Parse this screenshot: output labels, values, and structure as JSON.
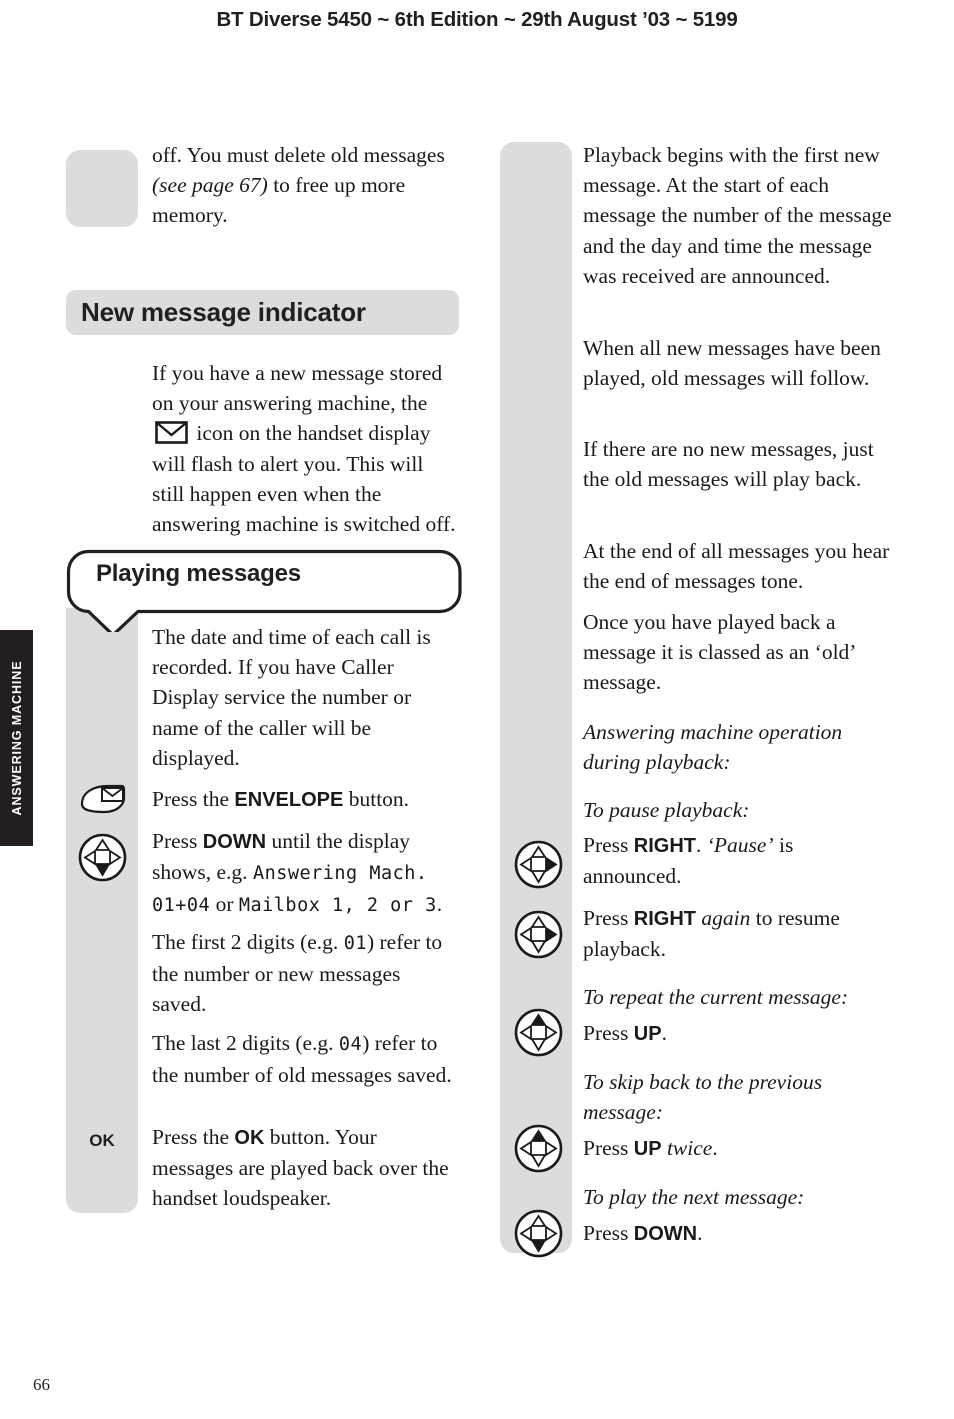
{
  "header": {
    "title": "BT Diverse 5450 ~ 6th Edition ~ 29th August ’03 ~ 5199"
  },
  "chapter_tab": {
    "label": "ANSWERING MACHINE"
  },
  "page_number": "66",
  "left_column": {
    "continued_paragraph_html": "off. You must delete old messages <i>(see page 67)</i> to free up more memory.",
    "section_heading": "New message indicator",
    "intro_paragraph_pre": "If you have a new message stored on your answering machine, the ",
    "intro_paragraph_post": " icon on the handset display will flash to alert you. This will still happen even when the answering machine is switched off.",
    "bubble_heading": "Playing messages",
    "steps": [
      {
        "icon": "envelope-button-icon",
        "text_html": "The date and time of each call is recorded. If you have Caller Display service the number or name of the caller will be displayed.",
        "has_icon": false
      },
      {
        "icon": "envelope-button-icon",
        "text_html": "Press the <b>ENVELOPE</b> button.",
        "has_icon": true
      },
      {
        "icon": "nav-key-down-icon",
        "text_html": "Press <b>DOWN</b> until the display shows, e.g. <span class=\"lcd\">Answering Mach. 01+04</span> or <span class=\"lcd\">Mailbox 1, 2 or 3</span>.",
        "has_icon": true
      },
      {
        "icon": "",
        "text_html": "The first 2 digits (e.g. <span class=\"lcd\">01</span>) refer to the number or new messages saved.",
        "has_icon": false
      },
      {
        "icon": "",
        "text_html": "The last 2 digits (e.g. <span class=\"lcd\">04</span>) refer to the number of old messages saved.",
        "has_icon": false
      },
      {
        "icon": "ok-button-label",
        "icon_label": "OK",
        "text_html": "Press the <b>OK</b> button. Your messages are played back over the handset loudspeaker.",
        "has_icon": true
      }
    ]
  },
  "right_column": {
    "paragraphs": [
      "Playback begins with the first new message. At the start of each message the number of the message and the day and time the message was received are announced.",
      "When all new messages have been played, old messages will follow.",
      "If there are no new messages, just the old messages will play back.",
      "At the end of all messages you hear the end of messages tone.",
      "Once you have played back a message it is classed as an ‘old’ message."
    ],
    "operation_heading": "Answering machine operation during playback:",
    "items": [
      {
        "sub_heading": "To pause playback:",
        "icon": "nav-key-right-icon",
        "text_html": "Press <b>RIGHT</b>. <i>‘Pause’</i> is announced."
      },
      {
        "sub_heading": "",
        "icon": "nav-key-right-icon",
        "text_html": "Press <b>RIGHT</b> <i>again</i> to resume playback."
      },
      {
        "sub_heading": "To repeat the current message:",
        "icon": "nav-key-up-icon",
        "text_html": "Press <b>UP</b>."
      },
      {
        "sub_heading": "To skip back to the previous message:",
        "icon": "nav-key-up-icon",
        "text_html": "Press <b>UP</b> <i>twice</i>."
      },
      {
        "sub_heading": "To play the next message:",
        "icon": "nav-key-down-icon",
        "text_html": "Press <b>DOWN</b>."
      }
    ]
  },
  "colors": {
    "gutter_grey": "#dcdcdc",
    "tab_black": "#231f20",
    "text": "#1a1a1a"
  }
}
